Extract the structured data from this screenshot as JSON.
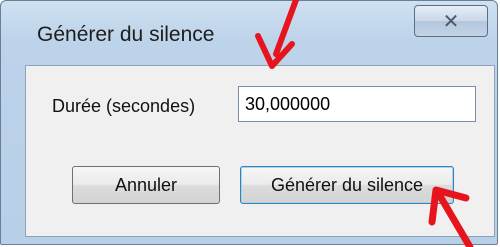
{
  "window": {
    "title": "Générer du silence",
    "close_glyph": "✕"
  },
  "form": {
    "duration_label": "Durée (secondes)",
    "duration_value": "30,000000"
  },
  "buttons": {
    "cancel_label": "Annuler",
    "generate_label": "Générer du silence"
  },
  "annotations": {
    "arrow_color": "#e8141d"
  }
}
